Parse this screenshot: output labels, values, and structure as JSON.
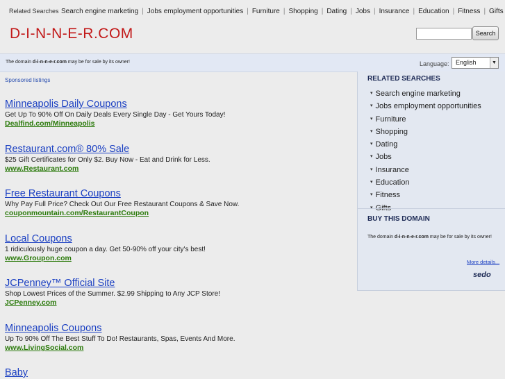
{
  "top_related": {
    "label": "Related Searches",
    "links": [
      "Search engine marketing",
      "Jobs employment opportunities",
      "Furniture",
      "Shopping",
      "Dating",
      "Jobs",
      "Insurance",
      "Education",
      "Fitness",
      "Gifts"
    ]
  },
  "site_title": "D-I-N-N-E-R.COM",
  "search": {
    "value": "",
    "button_label": "Search"
  },
  "notice": {
    "prefix": "The domain ",
    "domain": "d-i-n-n-e-r.com",
    "suffix": " may be for sale by its owner!"
  },
  "language": {
    "label": "Language:",
    "selected": "English"
  },
  "sponsored_label": "Sponsored listings",
  "listings": [
    {
      "title": "Minneapolis Daily Coupons",
      "desc": "Get Up To 90% Off On Daily Deals Every Single Day - Get Yours Today!",
      "url": "Dealfind.com/Minneapolis"
    },
    {
      "title": "Restaurant.com® 80% Sale",
      "desc": "$25 Gift Certificates for Only $2. Buy Now - Eat and Drink for Less.",
      "url": "www.Restaurant.com"
    },
    {
      "title": "Free Restaurant Coupons",
      "desc": "Why Pay Full Price? Check Out Our Free Restaurant Coupons & Save Now.",
      "url": "couponmountain.com/RestaurantCoupon"
    },
    {
      "title": "Local Coupons",
      "desc": "1 ridiculously huge coupon a day. Get 50-90% off your city's best!",
      "url": "www.Groupon.com"
    },
    {
      "title": "JCPenney™ Official Site",
      "desc": "Shop Lowest Prices of the Summer. $2.99 Shipping to Any JCP Store!",
      "url": "JCPenney.com"
    },
    {
      "title": "Minneapolis Coupons",
      "desc": "Up To 90% Off The Best Stuff To Do! Restaurants, Spas, Events And More.",
      "url": "www.LivingSocial.com"
    },
    {
      "title": "Baby",
      "desc": "",
      "url": ""
    }
  ],
  "right_panel": {
    "related_heading": "RELATED SEARCHES",
    "related_items": [
      "Search engine marketing",
      "Jobs employment opportunities",
      "Furniture",
      "Shopping",
      "Dating",
      "Jobs",
      "Insurance",
      "Education",
      "Fitness",
      "Gifts"
    ],
    "buy_heading": "BUY THIS DOMAIN",
    "buy_prefix": "The domain ",
    "buy_domain": "d-i-n-n-e-r.com",
    "buy_suffix": " may be for sale by its owner!",
    "more_details": "More details...",
    "logo": "sedo"
  },
  "colors": {
    "title_red": "#c21919",
    "link_blue": "#1a3fc2",
    "url_green": "#2b7a0b",
    "panel_bg": "#e3e8f1"
  }
}
